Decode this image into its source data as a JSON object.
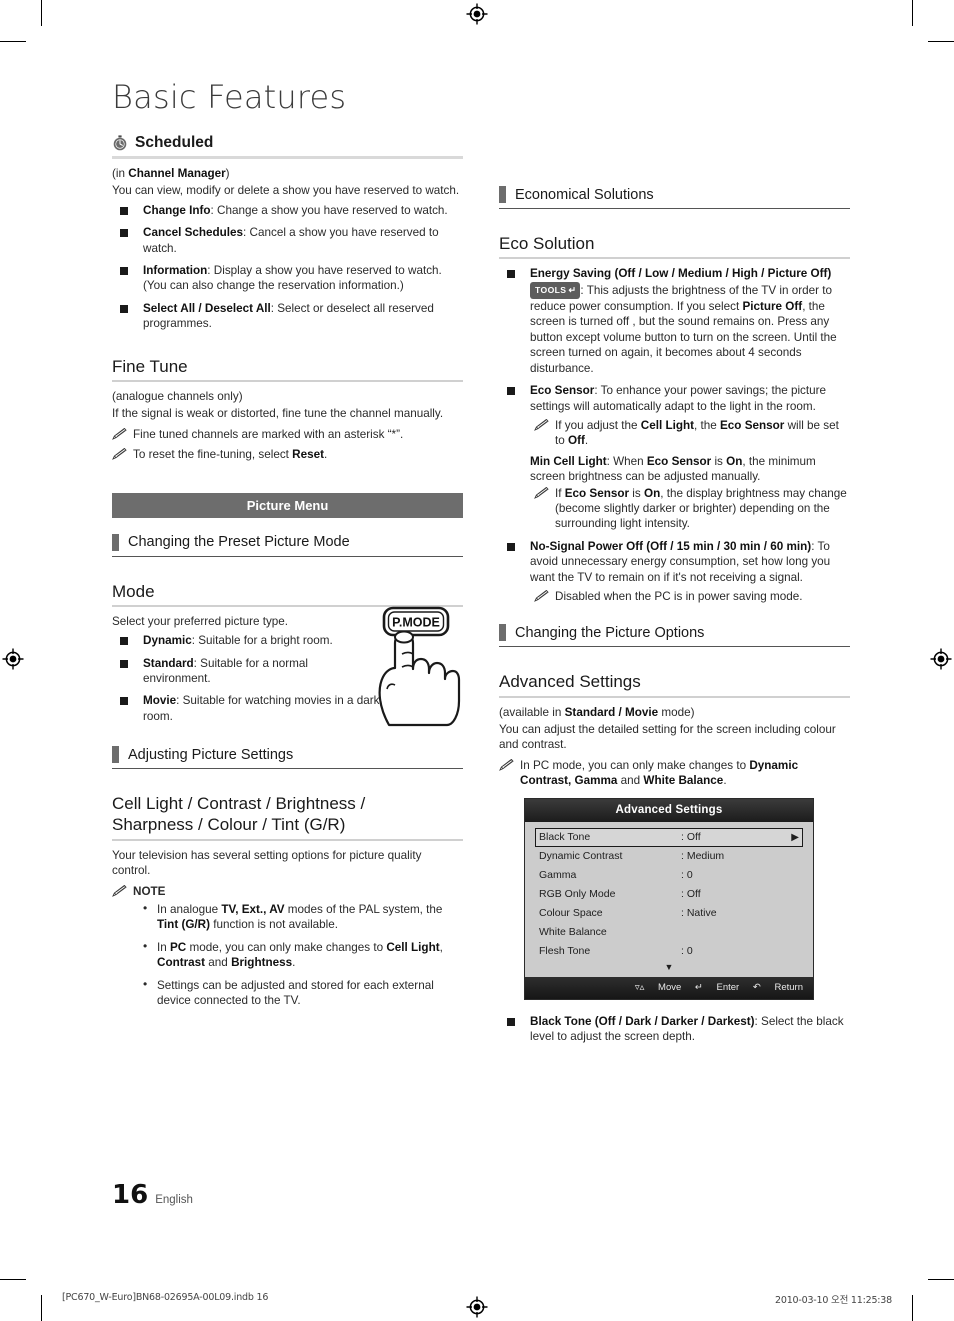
{
  "document": {
    "title": "Basic Features",
    "page_number": "16",
    "language_label": "English"
  },
  "left_column": {
    "scheduled": {
      "icon": "clock-icon",
      "heading": "Scheduled",
      "subtitle_prefix": "(in ",
      "subtitle_bold": "Channel Manager",
      "subtitle_suffix": ")",
      "intro": "You can view, modify or delete a show you have reserved to watch.",
      "items": [
        {
          "term": "Change Info",
          "desc": ": Change a show you have reserved to watch."
        },
        {
          "term": "Cancel Schedules",
          "desc": ": Cancel a show you have reserved to watch."
        },
        {
          "term": "Information",
          "desc": ": Display a show you have reserved to watch. (You can also change the reservation information.)"
        },
        {
          "term": "Select All / Deselect All",
          "desc": ": Select or deselect all reserved programmes."
        }
      ]
    },
    "fine_tune": {
      "heading": "Fine Tune",
      "note_analogue": "(analogue channels only)",
      "body": "If the signal is weak or distorted, fine tune the channel manually.",
      "note1": "Fine tuned channels are marked with an asterisk “*”.",
      "note2_prefix": "To reset the fine-tuning, select ",
      "note2_bold": "Reset",
      "note2_suffix": "."
    },
    "picture_menu_band": "Picture Menu",
    "changing_preset": {
      "heading": "Changing the Preset Picture Mode"
    },
    "mode": {
      "heading": "Mode",
      "intro": "Select your preferred picture type.",
      "items": [
        {
          "term": "Dynamic",
          "desc": ": Suitable for a bright room."
        },
        {
          "term": "Standard",
          "desc": ": Suitable for a normal environment."
        },
        {
          "term": "Movie",
          "desc": ": Suitable for watching movies in a dark room."
        }
      ],
      "remote_button_label": "P.MODE"
    },
    "adjusting_picture": {
      "heading": "Adjusting Picture Settings"
    },
    "cell_light": {
      "heading_line1": "Cell Light / Contrast / Brightness /",
      "heading_line2": "Sharpness / Colour / Tint (G/R)",
      "body": "Your television has several setting options for picture quality control.",
      "note_head": "NOTE",
      "bullets": [
        {
          "pre": "In analogue ",
          "b1": "TV, Ext., AV",
          "mid": " modes of the PAL system, the ",
          "b2": "Tint (G/R)",
          "post": " function is not available."
        },
        {
          "pre": "In ",
          "b1": "PC",
          "mid": " mode, you can only make changes to ",
          "b2": "Cell Light",
          "mid2": ", ",
          "b3": "Contrast",
          "mid3": " and ",
          "b4": "Brightness",
          "post": "."
        },
        {
          "pre": "Settings can be adjusted and stored for each external device connected to the TV.",
          "b1": "",
          "mid": "",
          "b2": "",
          "post": ""
        }
      ]
    }
  },
  "right_column": {
    "economical_solutions": {
      "heading": "Economical Solutions"
    },
    "eco_solution": {
      "heading": "Eco Solution",
      "energy_saving": {
        "term": "Energy Saving (Off / Low / Medium / High / Picture Off)",
        "badge": "TOOLS",
        "desc": ": This adjusts the brightness of the TV in order to reduce power consumption. If you select ",
        "bold_mid": "Picture Off",
        "desc2": ", the screen is turned off , but the sound remains on. Press any button except volume button to turn on the screen. Until the screen turned on again, it becomes about 4 seconds disturbance."
      },
      "eco_sensor": {
        "term": "Eco Sensor",
        "desc": ": To enhance your power savings; the picture settings will automatically adapt to the light in the room.",
        "note_pre": "If you adjust the ",
        "note_b1": "Cell Light",
        "note_mid": ", the ",
        "note_b2": "Eco Sensor",
        "note_mid2": " will be set to ",
        "note_b3": "Off",
        "note_post": "."
      },
      "min_cell_light": {
        "term": "Min Cell Light",
        "desc_pre": ": When ",
        "b1": "Eco Sensor",
        "desc_mid": " is ",
        "b2": "On",
        "desc_post": ", the minimum screen brightness can be adjusted manually.",
        "note_pre": "If ",
        "note_b1": "Eco Sensor",
        "note_mid": " is ",
        "note_b2": "On",
        "note_post": ", the display brightness may change (become slightly darker or brighter) depending on the surrounding light intensity."
      },
      "no_signal": {
        "term": "No-Signal Power Off (Off / 15 min / 30 min / 60 min)",
        "desc": ": To avoid unnecessary energy consumption, set how long you want the TV to remain on if it's not receiving a signal.",
        "note": "Disabled when the PC is in power saving mode."
      }
    },
    "changing_picture_options": {
      "heading": "Changing the Picture Options"
    },
    "advanced_settings": {
      "heading": "Advanced Settings",
      "availability_prefix": "(available in ",
      "availability_bold": "Standard / Movie",
      "availability_suffix": " mode)",
      "body": "You can adjust the detailed setting for the screen including colour and contrast.",
      "note_pre": "In PC mode, you can only make changes to ",
      "note_b1": "Dynamic Contrast, Gamma",
      "note_mid": " and ",
      "note_b2": "White Balance",
      "note_post": ".",
      "osd": {
        "title": "Advanced Settings",
        "rows": [
          {
            "label": "Black Tone",
            "value": ": Off",
            "selected": true,
            "arrow": "▶"
          },
          {
            "label": "Dynamic Contrast",
            "value": ": Medium",
            "selected": false,
            "arrow": ""
          },
          {
            "label": "Gamma",
            "value": ": 0",
            "selected": false,
            "arrow": ""
          },
          {
            "label": "RGB Only Mode",
            "value": ": Off",
            "selected": false,
            "arrow": ""
          },
          {
            "label": "Colour Space",
            "value": ": Native",
            "selected": false,
            "arrow": ""
          },
          {
            "label": "White Balance",
            "value": "",
            "selected": false,
            "arrow": ""
          },
          {
            "label": "Flesh Tone",
            "value": ": 0",
            "selected": false,
            "arrow": ""
          }
        ],
        "scroll_indicator": "▼",
        "footer": {
          "move": "Move",
          "enter": "Enter",
          "return": "Return"
        }
      },
      "black_tone": {
        "term": "Black Tone (Off / Dark / Darker / Darkest)",
        "desc": ": Select the black level to adjust the screen depth."
      }
    }
  },
  "footer": {
    "left": "[PC670_W-Euro]BN68-02695A-00L09.indb   16",
    "right": "2010-03-10   오전 11:25:38"
  },
  "colors": {
    "band_grey": "#6d6d6d",
    "rule_grey": "#d0d0d0",
    "text": "#2b2b2b",
    "osd_bg": "#cccccc",
    "osd_title_dark": "#1c1c1c"
  }
}
